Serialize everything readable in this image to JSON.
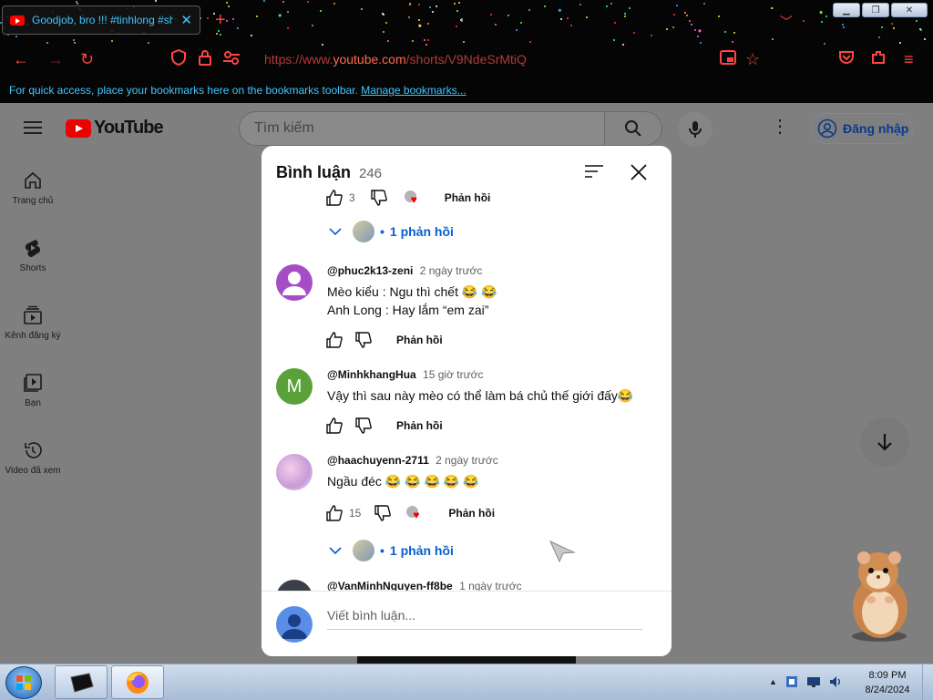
{
  "browser": {
    "tab_title": "Goodjob, bro !!! #tinhlong #sh",
    "url_prefix": "https://www.",
    "url_domain": "youtube.com",
    "url_path": "/shorts/V9NdeSrMtiQ",
    "bookmarks_text": "For quick access, place your bookmarks here on the bookmarks toolbar.",
    "bookmarks_link": "Manage bookmarks..."
  },
  "youtube": {
    "logo_text": "YouTube",
    "search_placeholder": "Tìm kiếm",
    "signin_label": "Đăng nhập",
    "sidebar": [
      {
        "label": "Trang chủ",
        "icon": "home-icon"
      },
      {
        "label": "Shorts",
        "icon": "shorts-icon"
      },
      {
        "label": "Kênh đăng ký",
        "icon": "subscriptions-icon"
      },
      {
        "label": "Bạn",
        "icon": "you-icon"
      },
      {
        "label": "Video đã xem",
        "icon": "history-icon"
      }
    ]
  },
  "comments_panel": {
    "title": "Bình luận",
    "count": "246",
    "top_partial": {
      "likes": "3",
      "reply_label": "Phản hồi"
    },
    "top_replies": "1 phản hồi",
    "comments": [
      {
        "author": "@phuc2k13-zeni",
        "time": "2 ngày trước",
        "lines": [
          "Mèo kiểu : Ngu thì chết 😂 😂",
          "Anh Long : Hay lắm “em zai”"
        ],
        "likes": "",
        "reply_label": "Phản hồi"
      },
      {
        "author": "@MinhkhangHua",
        "time": "15 giờ trước",
        "lines": [
          "Vậy thì sau này mèo có thể làm bá chủ thế giới đấy😂"
        ],
        "likes": "",
        "avatar_letter": "M",
        "reply_label": "Phản hồi"
      },
      {
        "author": "@haachuyenn-2711",
        "time": "2 ngày trước",
        "lines": [
          "Ngầu đéc 😂 😂 😂 😂 😂"
        ],
        "likes": "15",
        "reply_label": "Phản hồi",
        "replies": "1 phản hồi"
      },
      {
        "author": "@VanMinhNguyen-ff8be",
        "time": "1 ngày trước",
        "lines": []
      }
    ],
    "composer_placeholder": "Viết bình luận..."
  },
  "taskbar": {
    "time": "8:09 PM",
    "date": "8/24/2024"
  },
  "colors": {
    "yt_red": "#ff0000",
    "link_blue": "#065fd4",
    "firefox_accent": "#ff4040",
    "cyan_text": "#3ec8ff"
  }
}
